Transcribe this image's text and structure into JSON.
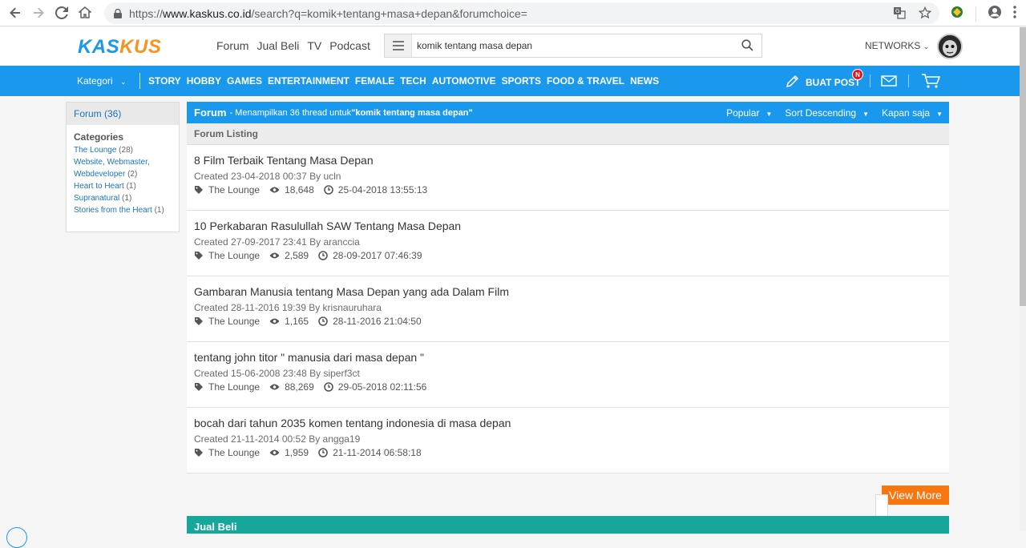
{
  "browser": {
    "url_prefix": "https://",
    "url_domain": "www.kaskus.co.id",
    "url_path": "/search?q=komik+tentang+masa+depan&forumchoice="
  },
  "header": {
    "logo_part1": "KAS",
    "logo_part2": "KUS",
    "nav": [
      "Forum",
      "Jual Beli",
      "TV",
      "Podcast"
    ],
    "search_value": "komik tentang masa depan",
    "networks_label": "NETWORKS"
  },
  "catbar": {
    "kategori_label": "Kategori",
    "links": [
      "STORY",
      "HOBBY",
      "GAMES",
      "ENTERTAINMENT",
      "FEMALE",
      "TECH",
      "AUTOMOTIVE",
      "SPORTS",
      "FOOD & TRAVEL",
      "NEWS"
    ],
    "buat_post_label": "BUAT POST",
    "badge": "N"
  },
  "sidebar": {
    "forum_count": "Forum (36)",
    "categories_title": "Categories",
    "categories": [
      {
        "name": "The Lounge",
        "count": "(28)"
      },
      {
        "name": "Website, Webmaster, Webdeveloper",
        "count": "(2)"
      },
      {
        "name": "Heart to Heart",
        "count": "(1)"
      },
      {
        "name": "Supranatural",
        "count": "(1)"
      },
      {
        "name": "Stories from the Heart",
        "count": "(1)"
      }
    ]
  },
  "main": {
    "title": "Forum",
    "summary_prefix": "- Menampilkan 36 thread untuk ",
    "summary_query": "\"komik tentang masa depan\"",
    "filters": [
      "Popular",
      "Sort Descending",
      "Kapan saja"
    ],
    "listing_label": "Forum Listing",
    "threads": [
      {
        "title": "8 Film Terbaik Tentang Masa Depan",
        "meta": "Created 23-04-2018 00:37 By ucln",
        "category": "The Lounge",
        "views": "18,648",
        "last": "25-04-2018 13:55:13"
      },
      {
        "title": "10 Perkabaran Rasulullah SAW Tentang Masa Depan",
        "meta": "Created 27-09-2017 23:41 By aranccia",
        "category": "The Lounge",
        "views": "2,589",
        "last": "28-09-2017 07:46:39"
      },
      {
        "title": "Gambaran Manusia tentang Masa Depan yang ada Dalam Film",
        "meta": "Created 28-11-2016 19:39 By krisnauruhara",
        "category": "The Lounge",
        "views": "1,165",
        "last": "28-11-2016 21:04:50"
      },
      {
        "title": "tentang john titor \" manusia dari masa depan \"",
        "meta": "Created 15-06-2008 23:48 By siperf3ct",
        "category": "The Lounge",
        "views": "88,269",
        "last": "29-05-2018 02:11:56"
      },
      {
        "title": "bocah dari tahun 2035 komen tentang indonesia di masa depan",
        "meta": "Created 21-11-2014 00:52 By angga19",
        "category": "The Lounge",
        "views": "1,959",
        "last": "21-11-2014 06:58:18"
      }
    ],
    "view_more": "View More",
    "jual_beli": "Jual Beli",
    "collapse": "«"
  },
  "colors": {
    "brand_blue": "#1998ed",
    "brand_orange": "#f7931e",
    "view_more": "#f7760f",
    "jual_beli_teal": "#17a79a"
  }
}
